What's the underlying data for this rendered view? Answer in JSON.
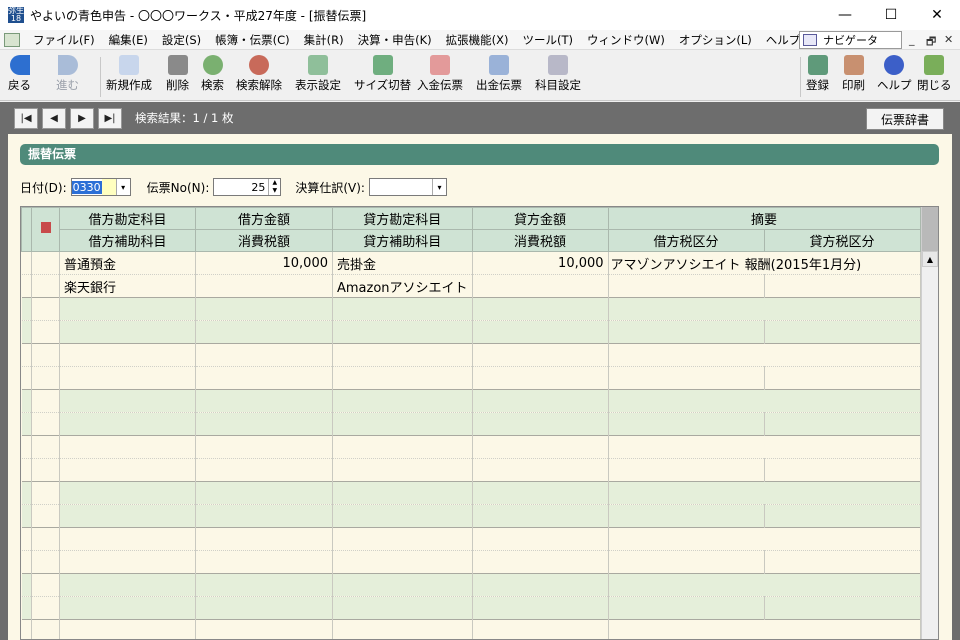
{
  "window": {
    "title": "やよいの青色申告 - 〇〇〇ワークス・平成27年度 - [振替伝票]",
    "min": "—",
    "max": "☐",
    "close": "✕"
  },
  "menu": [
    "ファイル(F)",
    "編集(E)",
    "設定(S)",
    "帳簿・伝票(C)",
    "集計(R)",
    "決算・申告(K)",
    "拡張機能(X)",
    "ツール(T)",
    "ウィンドウ(W)",
    "オプション(L)",
    "ヘルプ(H)"
  ],
  "navigator": {
    "label": "ナビゲータ",
    "mdi_min": "_",
    "mdi_restore": "🗗",
    "mdi_close": "✕"
  },
  "toolbar": {
    "back": "戻る",
    "forward": "進む",
    "new": "新規作成",
    "delete": "削除",
    "search": "検索",
    "search_clear": "検索解除",
    "display": "表示設定",
    "size": "サイズ切替",
    "income": "入金伝票",
    "outcome": "出金伝票",
    "subject": "科目設定",
    "register": "登録",
    "print": "印刷",
    "help": "ヘルプ",
    "close": "閉じる"
  },
  "nav": {
    "result": "検索結果：1 / 1 枚",
    "dict": "伝票辞書"
  },
  "form": {
    "title": "振替伝票",
    "date_label": "日付(D):",
    "date_value": "0330",
    "no_label": "伝票No(N):",
    "no_value": "25",
    "kessan_label": "決算仕訳(V):",
    "kessan_value": ""
  },
  "grid": {
    "headers": {
      "debit_account": "借方勘定科目",
      "debit_amount": "借方金額",
      "credit_account": "貸方勘定科目",
      "credit_amount": "貸方金額",
      "summary": "摘要",
      "debit_sub": "借方補助科目",
      "tax": "消費税額",
      "credit_sub": "貸方補助科目",
      "credit_tax": "消費税額",
      "debit_tax_class": "借方税区分",
      "credit_tax_class": "貸方税区分"
    },
    "rows": [
      {
        "debit_account": "普通預金",
        "debit_amount": "10,000",
        "credit_account": "売掛金",
        "credit_amount": "10,000",
        "summary": "アマゾンアソシエイト 報酬(2015年1月分)",
        "debit_sub": "楽天銀行",
        "debit_tax": "",
        "credit_sub": "Amazonアソシエイト",
        "credit_tax": "",
        "debit_tax_class": "",
        "credit_tax_class": ""
      }
    ],
    "empty_rows": 8
  },
  "colors": {
    "header_bg": "#cfe3d4",
    "title_bar": "#4f8a7a",
    "panel_bg": "#fcf8e7",
    "alt_row": "#e5efda"
  }
}
